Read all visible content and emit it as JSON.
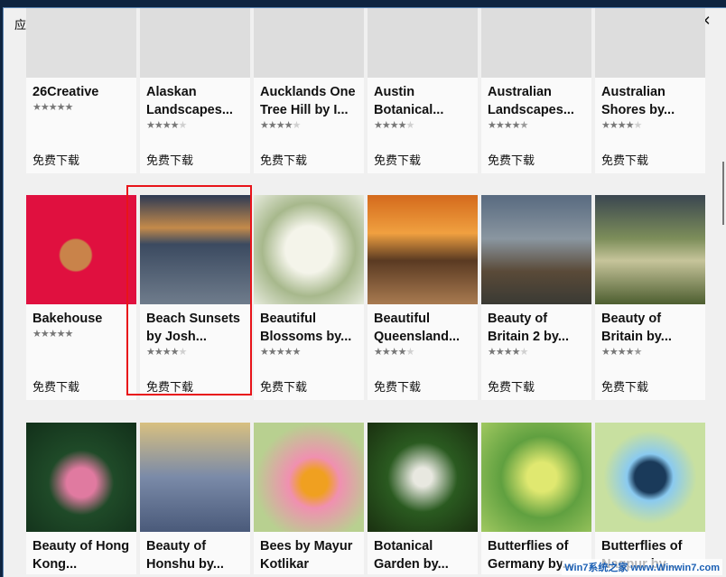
{
  "window": {
    "title": "应用商店"
  },
  "header": {
    "page_title": "主页"
  },
  "price_label": "免费下载",
  "rows": [
    [
      {
        "name": "26Creative",
        "rating": 5
      },
      {
        "name": "Alaskan Landscapes...",
        "rating": 4
      },
      {
        "name": "Aucklands One Tree Hill by I...",
        "rating": 4
      },
      {
        "name": "Austin Botanical...",
        "rating": 4
      },
      {
        "name": "Australian Landscapes...",
        "rating": 4.5
      },
      {
        "name": "Australian Shores by...",
        "rating": 4
      }
    ],
    [
      {
        "name": "Bakehouse",
        "rating": 5
      },
      {
        "name": "Beach Sunsets by Josh...",
        "rating": 4
      },
      {
        "name": "Beautiful Blossoms by...",
        "rating": 5
      },
      {
        "name": "Beautiful Queensland...",
        "rating": 4
      },
      {
        "name": "Beauty of Britain 2 by...",
        "rating": 4
      },
      {
        "name": "Beauty of Britain by...",
        "rating": 4.5
      }
    ],
    [
      {
        "name": "Beauty of Hong Kong..."
      },
      {
        "name": "Beauty of Honshu by..."
      },
      {
        "name": "Bees by Mayur Kotlikar"
      },
      {
        "name": "Botanical Garden by..."
      },
      {
        "name": "Butterflies of Germany by..."
      },
      {
        "name": "Butterflies of Nagpur by..."
      }
    ]
  ],
  "watermark": "Win7系统之家 www.Winwin7.com"
}
